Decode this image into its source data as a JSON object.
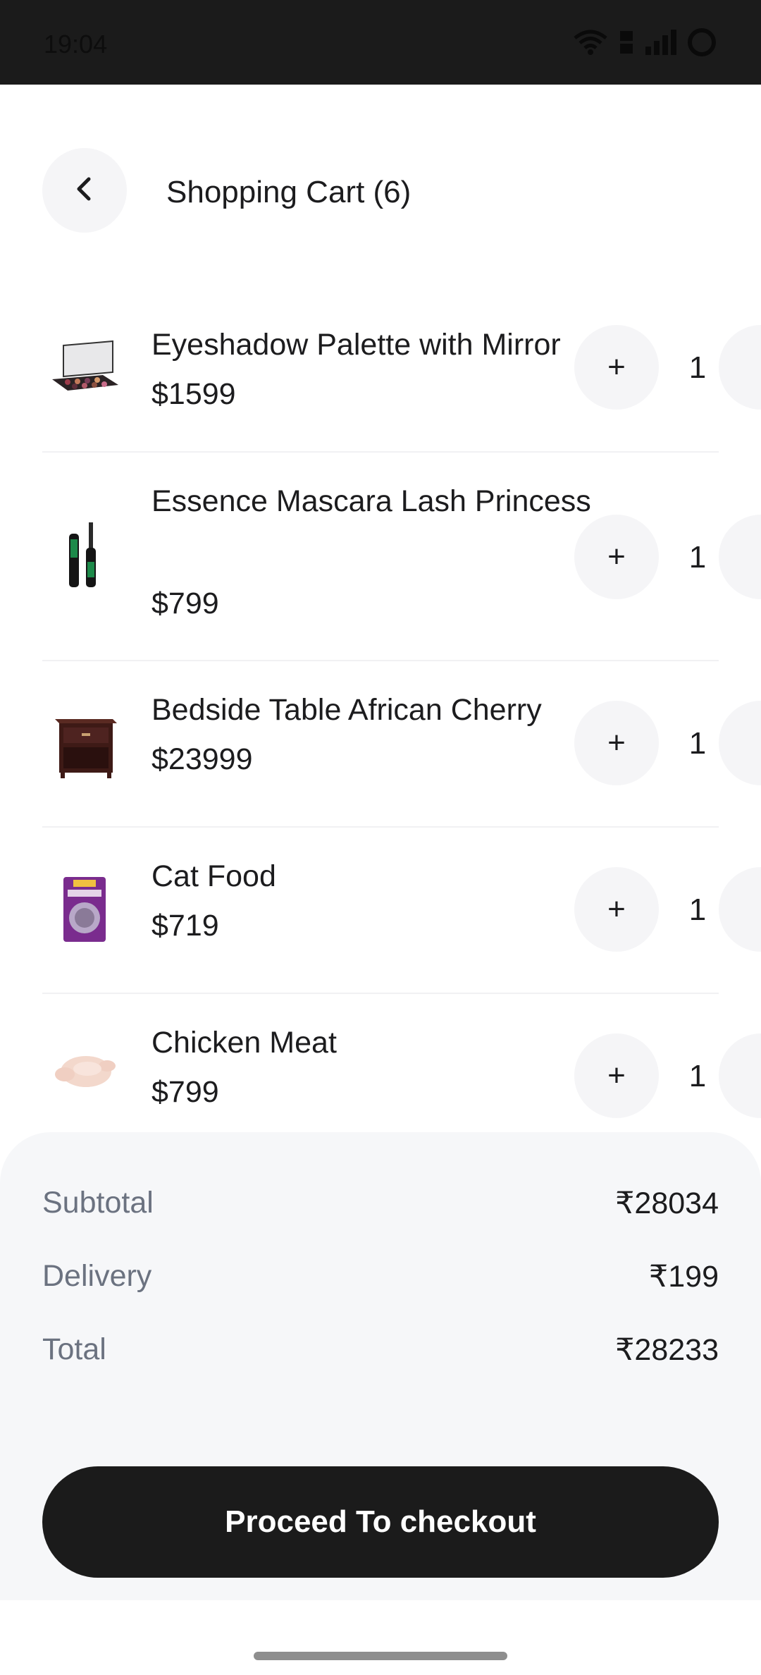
{
  "status_bar": {
    "time": "19:04",
    "icons": [
      "wifi-icon",
      "volte-icon",
      "signal-icon",
      "battery-icon"
    ]
  },
  "header": {
    "title": "Shopping Cart (6)",
    "back_icon": "chevron-left-icon"
  },
  "cart": {
    "items": [
      {
        "name": "Eyeshadow Palette with Mirror",
        "price": "$1599",
        "quantity": "1",
        "plus": "+",
        "minus": "-",
        "image": "eyeshadow-palette-image"
      },
      {
        "name": "Essence Mascara Lash Princess",
        "price": "$799",
        "quantity": "1",
        "plus": "+",
        "minus": "-",
        "image": "mascara-image"
      },
      {
        "name": "Bedside Table African Cherry",
        "price": "$23999",
        "quantity": "1",
        "plus": "+",
        "minus": "-",
        "image": "bedside-table-image"
      },
      {
        "name": "Cat Food",
        "price": "$719",
        "quantity": "1",
        "plus": "+",
        "minus": "-",
        "image": "cat-food-image"
      },
      {
        "name": "Chicken Meat",
        "price": "$799",
        "quantity": "1",
        "plus": "+",
        "minus": "-",
        "image": "chicken-meat-image"
      }
    ]
  },
  "summary": {
    "subtotal_label": "Subtotal",
    "subtotal_value": "₹28034",
    "delivery_label": "Delivery",
    "delivery_value": "₹199",
    "total_label": "Total",
    "total_value": "₹28233"
  },
  "checkout": {
    "label": "Proceed To checkout"
  },
  "colors": {
    "primary": "#1b1b1b",
    "surface": "#f6f7f9",
    "muted_text": "#6b7280"
  }
}
